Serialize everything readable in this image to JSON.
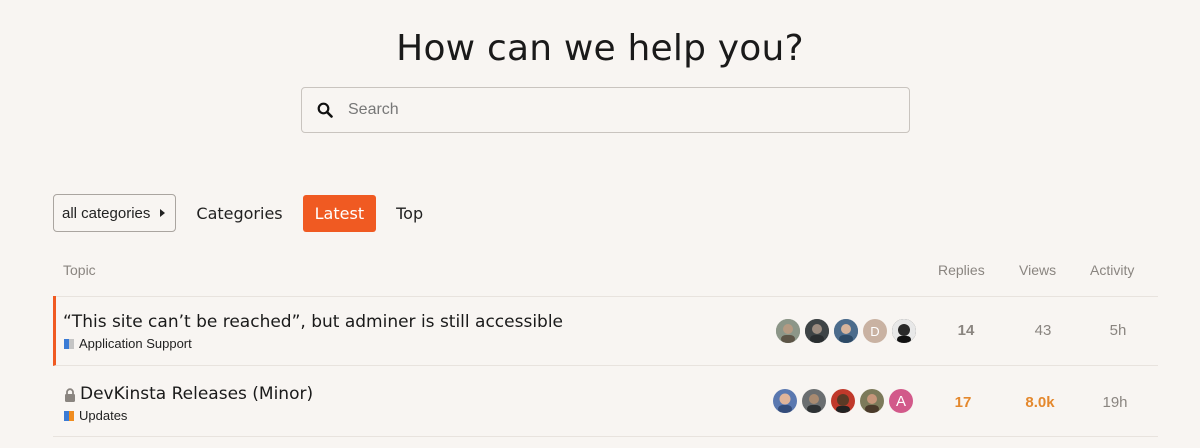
{
  "hero": {
    "title": "How can we help you?"
  },
  "search": {
    "placeholder": "Search",
    "icon": "search-icon"
  },
  "nav": {
    "category_dropdown": "all categories",
    "links": [
      "Categories",
      "Latest",
      "Top"
    ],
    "active": "Latest",
    "accent_color": "#f05a22"
  },
  "table": {
    "headers": {
      "topic": "Topic",
      "replies": "Replies",
      "views": "Views",
      "activity": "Activity"
    },
    "rows": [
      {
        "title": "“This site can’t be reached”, but adminer is still accessible",
        "category": "Application Support",
        "category_colors": [
          "#3a7bd5",
          "#c5c5c5"
        ],
        "replies": "14",
        "views": "43",
        "activity": "5h",
        "locked": false,
        "avatars": [
          "avatar-1",
          "avatar-2",
          "avatar-3",
          "D",
          "avatar-5"
        ]
      },
      {
        "title": "DevKinsta Releases (Minor)",
        "category": "Updates",
        "category_colors": [
          "#3a7bd5",
          "#f08c1e"
        ],
        "replies": "17",
        "views": "8.0k",
        "activity": "19h",
        "locked": true,
        "avatars": [
          "avatar-1",
          "avatar-2",
          "avatar-3",
          "avatar-4",
          "A"
        ]
      }
    ]
  }
}
